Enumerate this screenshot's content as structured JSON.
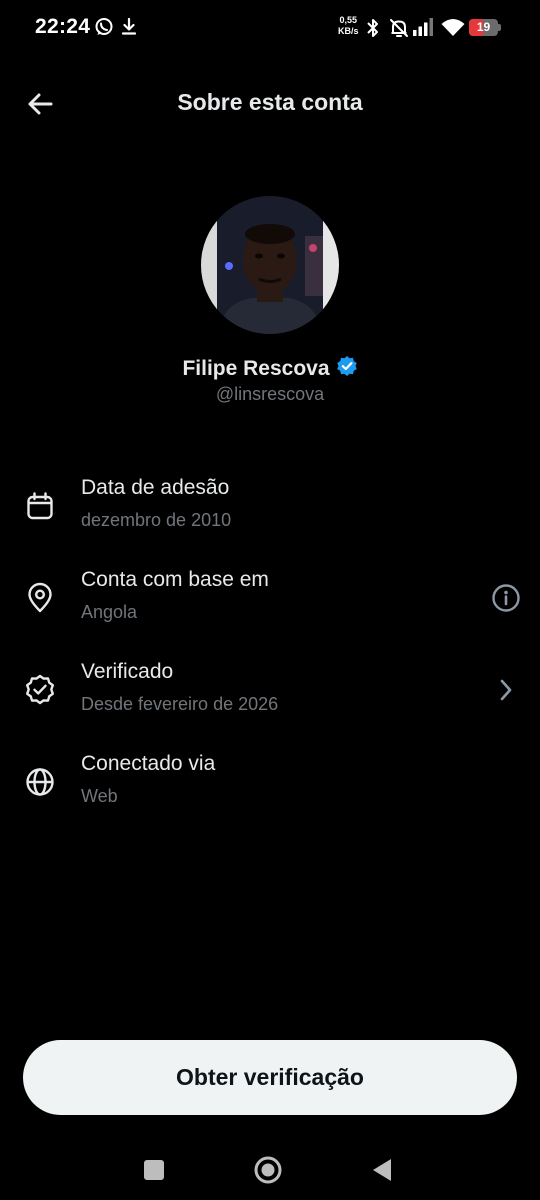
{
  "status_bar": {
    "time": "22:24",
    "net_speed_value": "0,55",
    "net_speed_unit": "KB/s",
    "battery_level": "19",
    "icons": [
      "whatsapp-icon",
      "download-icon",
      "bluetooth-icon",
      "bell-muted-icon",
      "signal-icon",
      "wifi-icon",
      "battery-icon"
    ]
  },
  "header": {
    "title": "Sobre esta conta",
    "back_icon": "arrow-left-icon"
  },
  "profile": {
    "display_name": "Filipe Rescova",
    "handle": "@linsrescova",
    "verified_badge_color": "#1d9bf0"
  },
  "info": [
    {
      "title": "Data de adesão",
      "subtitle": "dezembro de 2010",
      "icon": "calendar-icon"
    },
    {
      "title": "Conta com base em",
      "subtitle": "Angola",
      "icon": "location-pin-icon",
      "trailing": "info-icon"
    },
    {
      "title": "Verificado",
      "subtitle": "Desde fevereiro de 2026",
      "icon": "verified-check-icon",
      "trailing": "chevron-right-icon"
    },
    {
      "title": "Conectado via",
      "subtitle": "Web",
      "icon": "globe-icon"
    }
  ],
  "cta": {
    "label": "Obter verificação"
  },
  "colors": {
    "background": "#000000",
    "primary_text": "#e7e9ea",
    "secondary_text": "#71767b",
    "cta_background": "#eff3f4",
    "battery_low": "#e5383b"
  },
  "nav": {
    "icons": [
      "recents-square-icon",
      "home-circle-icon",
      "back-triangle-icon"
    ]
  }
}
